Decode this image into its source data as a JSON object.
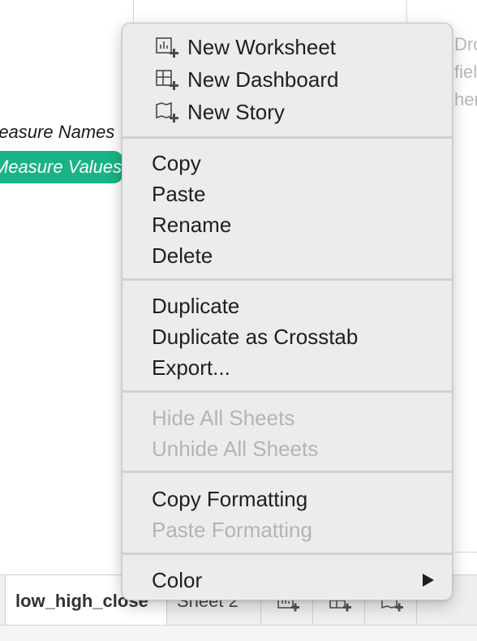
{
  "data_pane": {
    "fields": [
      {
        "label": "Measure Names"
      },
      {
        "label": "Measure Values"
      }
    ]
  },
  "worksheet": {
    "hint_lines": [
      "Drop",
      "fields",
      "here"
    ]
  },
  "tab_bar": {
    "tabs": [
      {
        "label": "low_high_close",
        "active": true
      },
      {
        "label": "Sheet 2",
        "active": false
      }
    ],
    "buttons": [
      {
        "icon": "new-worksheet-icon"
      },
      {
        "icon": "new-dashboard-icon"
      },
      {
        "icon": "new-story-icon"
      }
    ]
  },
  "context_menu": {
    "groups": [
      [
        {
          "label": "New Worksheet",
          "icon": "new-worksheet-icon",
          "enabled": true
        },
        {
          "label": "New Dashboard",
          "icon": "new-dashboard-icon",
          "enabled": true
        },
        {
          "label": "New Story",
          "icon": "new-story-icon",
          "enabled": true
        }
      ],
      [
        {
          "label": "Copy",
          "enabled": true
        },
        {
          "label": "Paste",
          "enabled": true
        },
        {
          "label": "Rename",
          "enabled": true
        },
        {
          "label": "Delete",
          "enabled": true
        }
      ],
      [
        {
          "label": "Duplicate",
          "enabled": true
        },
        {
          "label": "Duplicate as Crosstab",
          "enabled": true
        },
        {
          "label": "Export...",
          "enabled": true
        }
      ],
      [
        {
          "label": "Hide All Sheets",
          "enabled": false
        },
        {
          "label": "Unhide All Sheets",
          "enabled": false
        }
      ],
      [
        {
          "label": "Copy Formatting",
          "enabled": true
        },
        {
          "label": "Paste Formatting",
          "enabled": false
        }
      ],
      [
        {
          "label": "Color",
          "enabled": true,
          "submenu": true,
          "submenu_icon": "chevron-right-icon"
        }
      ]
    ]
  },
  "colors": {
    "accent_green": "#1ab385",
    "menu_background": "#ececec",
    "disabled_text": "#b4b4b4"
  }
}
